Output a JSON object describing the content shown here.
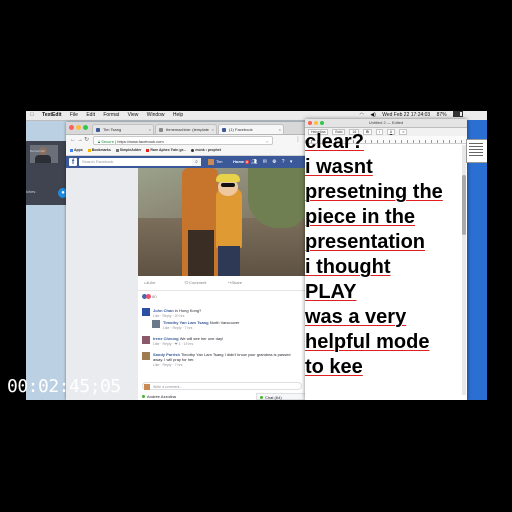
{
  "menubar": {
    "apple": "",
    "app": "TextEdit",
    "items": [
      "File",
      "Edit",
      "Format",
      "View",
      "Window",
      "Help"
    ],
    "clock": "Wed Feb 22  17:24:03",
    "battery": "87%"
  },
  "call": {
    "caller_name": "Darnell Gill",
    "sub": "iches"
  },
  "browser": {
    "tabs": [
      {
        "label": "Tim Tsang",
        "active": false
      },
      {
        "label": "thmemachine: (template",
        "active": false
      },
      {
        "label": "(1) Facebook",
        "active": true
      }
    ],
    "address": {
      "secure_label": "Secure",
      "url": "https://www.facebook.com"
    },
    "bookmarks": [
      "Apps",
      "Bookmarks",
      "SimpleAdder",
      "Rare Aphex Twin ge...",
      "monk • prophet"
    ]
  },
  "facebook": {
    "search_placeholder": "Search Facebook",
    "user": "Tim",
    "home": "Home",
    "home_badge": "9",
    "actions": [
      "Like",
      "Comment",
      "Share"
    ],
    "reaction_count": "80",
    "comments": [
      {
        "name": "John Chan",
        "text": "in Hong Kong?",
        "meta": "Like · Reply · 20 hrs"
      },
      {
        "name": "Timothy Yan Lam Tsang",
        "text": "North Vancouver",
        "meta": "Like · Reply · 7 hrs"
      },
      {
        "name": "Irene Cheung",
        "text": "We will see her one day!",
        "meta": "Like · Reply · ❤ 1 · 19 hrs"
      },
      {
        "name": "Sandy Parrish",
        "text": "Timothy Yan Lam Tsang I didn't know your grandma is passed",
        "text2": "away. I will pray for her.",
        "meta": "Like · Reply · 7 hrs"
      }
    ],
    "comment_placeholder": "Write a comment...",
    "online_user": "Andrée Azzolina",
    "chat_label": "Chat (64)"
  },
  "textedit": {
    "title": "Untitled 2 — Edited",
    "toolbar": [
      "Helvetica",
      "Bold",
      "16"
    ],
    "lines": [
      "clear?",
      "i wasnt",
      "presetning the",
      "piece in the",
      "presentation",
      "i thought",
      "PLAY",
      "was a very",
      "helpful mode",
      "to kee"
    ]
  },
  "timecode": "00:02:45;05",
  "colors": {
    "facebook_blue": "#3b5998",
    "spell_underline": "#e02020",
    "call_accept": "#1e8be0",
    "call_decline": "#e23b30"
  }
}
